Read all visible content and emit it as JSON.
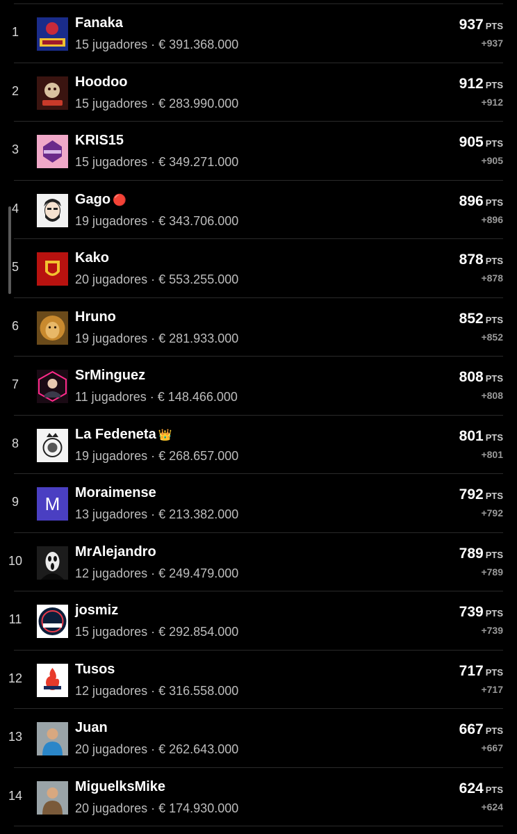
{
  "pts_label": "PTS",
  "players_suffix": "jugadores",
  "separator": "·",
  "currency": "€",
  "rows": [
    {
      "rank": "1",
      "name": "Fanaka",
      "badge": "",
      "players": "15 jugadores",
      "value": "€ 391.368.000",
      "points": "937",
      "delta": "+937",
      "avatar_icon": "dios-team-icon",
      "avatar_color": "#1a2c8a"
    },
    {
      "rank": "2",
      "name": "Hoodoo",
      "badge": "",
      "players": "15 jugadores",
      "value": "€ 283.990.000",
      "points": "912",
      "delta": "+912",
      "avatar_icon": "hoodoo-mascot-icon",
      "avatar_color": "#3a1410"
    },
    {
      "rank": "3",
      "name": "KRIS15",
      "badge": "",
      "players": "15 jugadores",
      "value": "€ 349.271.000",
      "points": "905",
      "delta": "+905",
      "avatar_icon": "kris-logo-icon",
      "avatar_color": "#f0a8c8"
    },
    {
      "rank": "4",
      "name": "Gago",
      "badge": "🔴",
      "players": "19 jugadores",
      "value": "€ 343.706.000",
      "points": "896",
      "delta": "+896",
      "avatar_icon": "bearded-man-icon",
      "avatar_color": "#f2f2f2"
    },
    {
      "rank": "5",
      "name": "Kako",
      "badge": "",
      "players": "20 jugadores",
      "value": "€ 553.255.000",
      "points": "878",
      "delta": "+878",
      "avatar_icon": "spain-crest-icon",
      "avatar_color": "#b8120f"
    },
    {
      "rank": "6",
      "name": "Hruno",
      "badge": "",
      "players": "19 jugadores",
      "value": "€ 281.933.000",
      "points": "852",
      "delta": "+852",
      "avatar_icon": "lion-icon",
      "avatar_color": "#c98a2e"
    },
    {
      "rank": "7",
      "name": "SrMinguez",
      "badge": "",
      "players": "11 jugadores",
      "value": "€ 148.466.000",
      "points": "808",
      "delta": "+808",
      "avatar_icon": "neon-portrait-icon",
      "avatar_color": "#1a0a14"
    },
    {
      "rank": "8",
      "name": "La Fedeneta",
      "badge": "👑",
      "players": "19 jugadores",
      "value": "€ 268.657.000",
      "points": "801",
      "delta": "+801",
      "avatar_icon": "crown-crest-icon",
      "avatar_color": "#f4f4f4"
    },
    {
      "rank": "9",
      "name": "Moraimense",
      "badge": "",
      "players": "13 jugadores",
      "value": "€ 213.382.000",
      "points": "792",
      "delta": "+792",
      "avatar_icon": "letter-m-icon",
      "avatar_color": "#4a3fc2",
      "avatar_letter": "M"
    },
    {
      "rank": "10",
      "name": "MrAlejandro",
      "badge": "",
      "players": "12 jugadores",
      "value": "€ 249.479.000",
      "points": "789",
      "delta": "+789",
      "avatar_icon": "ghostface-mask-icon",
      "avatar_color": "#1c1c1c"
    },
    {
      "rank": "11",
      "name": "josmiz",
      "badge": "",
      "players": "15 jugadores",
      "value": "€ 292.854.000",
      "points": "739",
      "delta": "+739",
      "avatar_icon": "josmiz-logo-icon",
      "avatar_color": "#0c1e3a"
    },
    {
      "rank": "12",
      "name": "Tusos",
      "badge": "",
      "players": "12 jugadores",
      "value": "€ 316.558.000",
      "points": "717",
      "delta": "+717",
      "avatar_icon": "flame-logo-icon",
      "avatar_color": "#ffffff"
    },
    {
      "rank": "13",
      "name": "Juan",
      "badge": "",
      "players": "20 jugadores",
      "value": "€ 262.643.000",
      "points": "667",
      "delta": "+667",
      "avatar_icon": "player-photo-icon",
      "avatar_color": "#2a86c8"
    },
    {
      "rank": "14",
      "name": "MiguelksMike",
      "badge": "",
      "players": "20 jugadores",
      "value": "€ 174.930.000",
      "points": "624",
      "delta": "+624",
      "avatar_icon": "player-photo-icon",
      "avatar_color": "#7a5a3a"
    }
  ]
}
